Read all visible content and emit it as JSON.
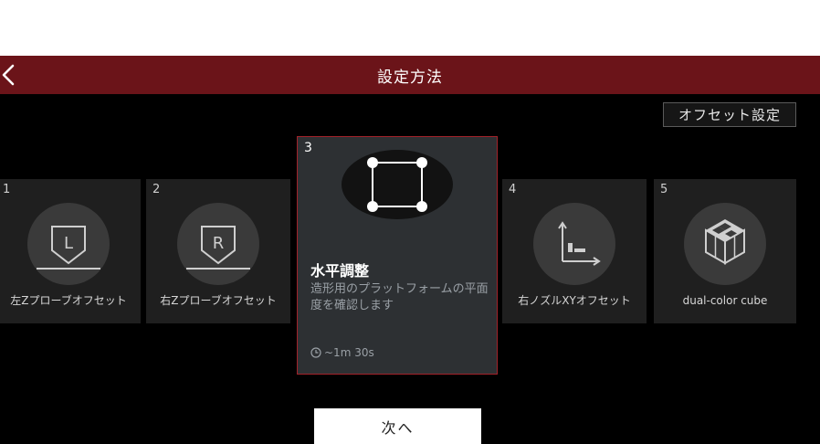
{
  "header": {
    "title": "設定方法"
  },
  "offset_button": {
    "label": "オフセット設定"
  },
  "steps": [
    {
      "num": "1",
      "label": "左Zプローブオフセット",
      "icon": "probe-left-icon"
    },
    {
      "num": "2",
      "label": "右Zプローブオフセット",
      "icon": "probe-right-icon"
    },
    {
      "num": "3",
      "title": "水平調整",
      "desc": "造形用のプラットフォームの平面度を確認します",
      "time": "~1m 30s",
      "icon": "bed-level-icon",
      "selected": true
    },
    {
      "num": "4",
      "label": "右ノズルXYオフセット",
      "icon": "xy-axis-icon"
    },
    {
      "num": "5",
      "label": "dual-color cube",
      "icon": "cube-icon"
    }
  ],
  "next_button": {
    "label": "次へ"
  },
  "colors": {
    "header_bg": "#6b1419",
    "selected_border": "#a3222a"
  }
}
